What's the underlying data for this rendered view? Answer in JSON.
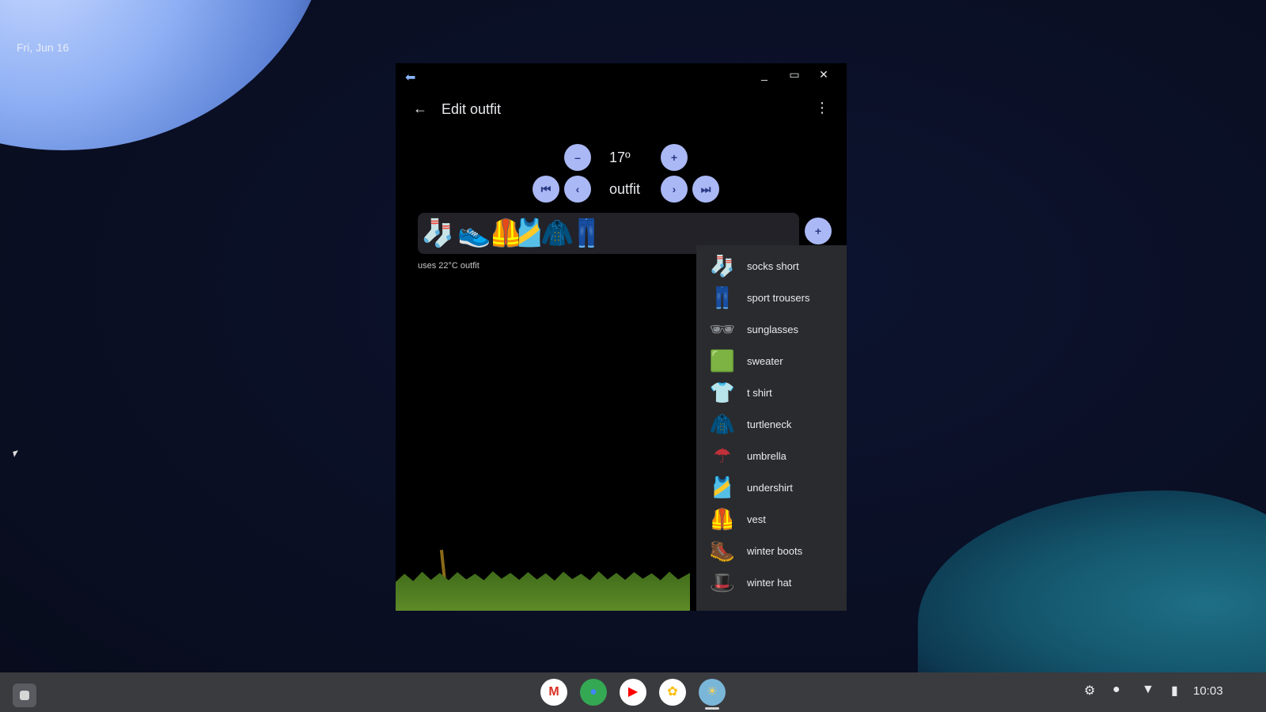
{
  "desktop": {
    "date": "Fri, Jun 16"
  },
  "window": {
    "title_bar": {
      "back_icon": "arrow-left-icon",
      "minimize": "_",
      "maximize": "▭",
      "close": "✕"
    },
    "app_bar": {
      "title": "Edit outfit",
      "back": "←",
      "more": "⋮"
    },
    "temperature": {
      "decrease": "–",
      "value": "17º",
      "increase": "+"
    },
    "outfit_nav": {
      "first": "⏮",
      "prev": "‹",
      "label": "outfit",
      "next": "›",
      "last": "⏭"
    },
    "outfit_items": [
      {
        "name": "sock",
        "glyph": "🧦"
      },
      {
        "name": "sneaker",
        "glyph": "👟"
      },
      {
        "name": "vest",
        "glyph": "🦺"
      },
      {
        "name": "undershirt",
        "glyph": "🎽"
      },
      {
        "name": "sweater",
        "glyph": "🧥"
      },
      {
        "name": "trousers",
        "glyph": "👖"
      }
    ],
    "add": "+",
    "note": "uses 22°C outfit",
    "dropdown": [
      {
        "label": "socks short",
        "glyph": "🧦",
        "color": "#bfa88a"
      },
      {
        "label": "sport trousers",
        "glyph": "👖",
        "color": "#9aa4a8"
      },
      {
        "label": "sunglasses",
        "glyph": "🕶",
        "color": "#8a8f94"
      },
      {
        "label": "sweater",
        "glyph": "🟩",
        "color": "#6cc06c"
      },
      {
        "label": "t shirt",
        "glyph": "👕",
        "color": "#3f8ef0"
      },
      {
        "label": "turtleneck",
        "glyph": "🧥",
        "color": "#f08a2a"
      },
      {
        "label": "umbrella",
        "glyph": "☂",
        "color": "#c0303a"
      },
      {
        "label": "undershirt",
        "glyph": "🎽",
        "color": "#d8d8d8"
      },
      {
        "label": "vest",
        "glyph": "🦺",
        "color": "#e86a1a"
      },
      {
        "label": "winter boots",
        "glyph": "🥾",
        "color": "#3a3a3a"
      },
      {
        "label": "winter hat",
        "glyph": "🎩",
        "color": "#3cbf6a"
      }
    ]
  },
  "shelf": {
    "apps": [
      {
        "name": "gmail",
        "glyph": "M",
        "bg": "#ffffff",
        "fg": "#d93025"
      },
      {
        "name": "chrome",
        "glyph": "●",
        "bg": "#34a853",
        "fg": "#4285f4"
      },
      {
        "name": "youtube",
        "glyph": "▶",
        "bg": "#ffffff",
        "fg": "#ff0000"
      },
      {
        "name": "photos",
        "glyph": "✿",
        "bg": "#ffffff",
        "fg": "#fbbc04"
      },
      {
        "name": "outfit-app",
        "glyph": "☀",
        "bg": "#7ab6d8",
        "fg": "#f4d35e"
      }
    ],
    "tray": {
      "settings": "⚙",
      "notification": "●",
      "wifi": "▼",
      "battery": "▮",
      "time": "10:03"
    }
  }
}
